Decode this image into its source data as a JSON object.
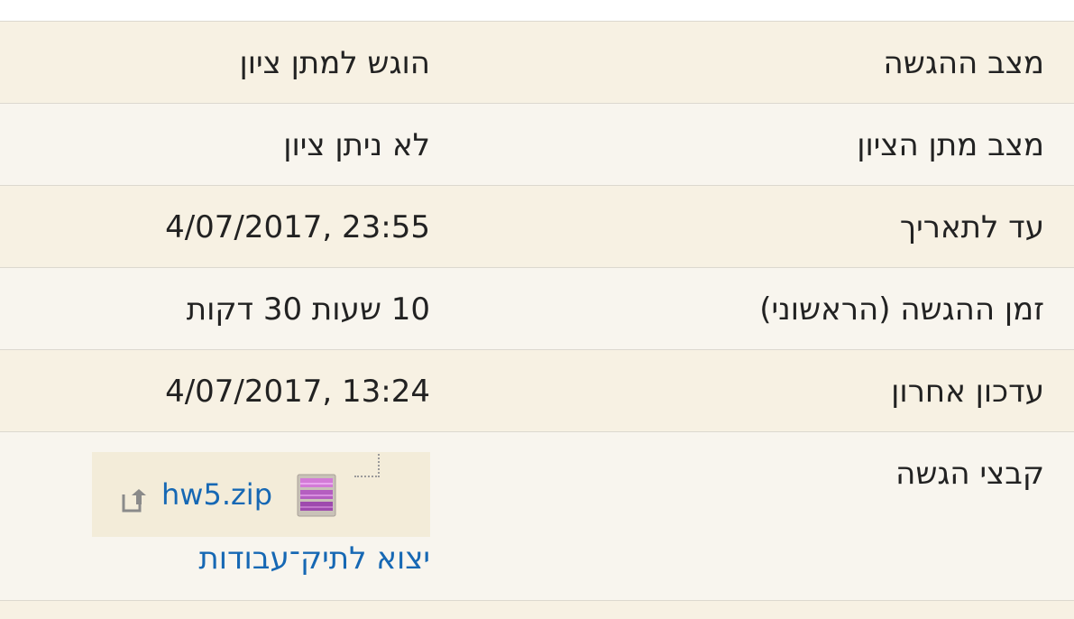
{
  "submission_status": {
    "rows": [
      {
        "label": "מצב ההגשה",
        "value": "הוגש למתן ציון"
      },
      {
        "label": "מצב מתן הציון",
        "value": "לא ניתן ציון"
      },
      {
        "label": "עד לתאריך",
        "value": "4/07/2017, 23:55"
      },
      {
        "label": "זמן ההגשה (הראשוני)",
        "value": "10 שעות 30 דקות"
      },
      {
        "label": "עדכון אחרון",
        "value": "4/07/2017, 13:24"
      }
    ],
    "files": {
      "label": "קבצי הגשה",
      "file_name": "hw5.zip",
      "file_icon": "archive-icon",
      "action_icon": "export-icon",
      "export_link": "יצוא לתיק־עבודות"
    }
  }
}
